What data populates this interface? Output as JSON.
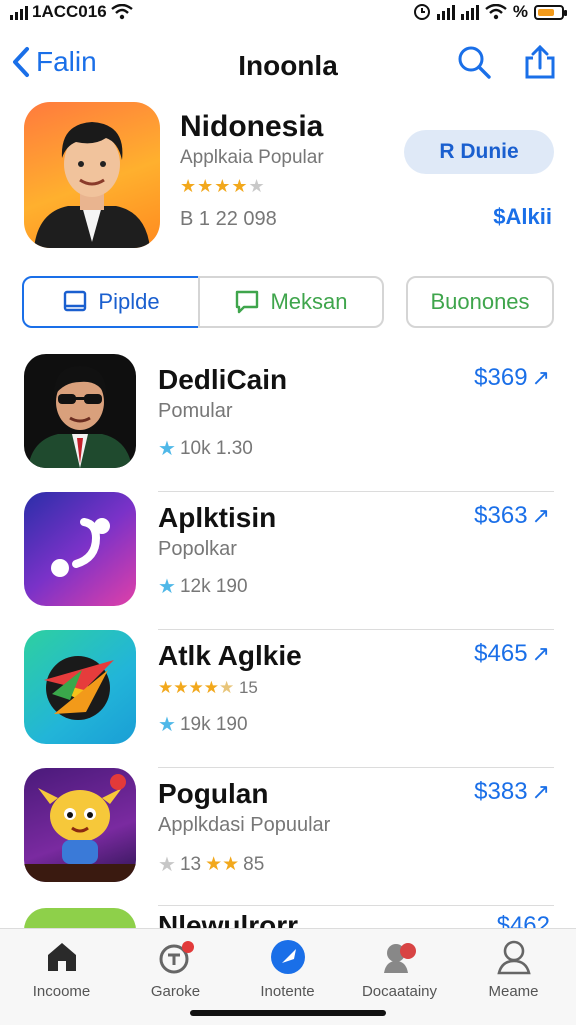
{
  "status_bar": {
    "carrier": "1ACC016",
    "right_label": "%"
  },
  "nav": {
    "back_label": "Falin",
    "title": "Inoonla"
  },
  "featured": {
    "name": "Nidonesia",
    "subtitle": "Applkaia Popular",
    "rating_stars": 4,
    "meta": "B 1 22 098",
    "button_label": "R Dunie",
    "price": "$Alkii"
  },
  "segments": [
    {
      "label": "Piplde",
      "icon": "book-icon"
    },
    {
      "label": "Meksan",
      "icon": "message-icon"
    },
    {
      "label": "Buonones",
      "icon": "tag-icon"
    }
  ],
  "apps": [
    {
      "name": "DedliCain",
      "subtitle": "Pomular",
      "rating_text": "10k 1.30",
      "price": "$369",
      "icon": "sunglasses-avatar-icon"
    },
    {
      "name": "Aplktisin",
      "subtitle": "Popolkar",
      "rating_text": "12k 190",
      "price": "$363",
      "icon": "music-note-icon"
    },
    {
      "name": "Atlk Aglkie",
      "subtitle": "",
      "stars_text": "15",
      "rating_text": "19k 190",
      "price": "$465",
      "icon": "vinyl-disc-icon"
    },
    {
      "name": "Pogulan",
      "subtitle": "Applkdasi Popuular",
      "stars_text": "85",
      "rating_text": "13",
      "price": "$383",
      "icon": "cartoon-character-icon"
    }
  ],
  "peek": {
    "name": "Nlewulrorr",
    "price": "$462"
  },
  "tabbar": [
    {
      "label": "Incoome",
      "icon": "home-icon"
    },
    {
      "label": "Garoke",
      "icon": "chat-badge-icon"
    },
    {
      "label": "Inotente",
      "icon": "play-icon"
    },
    {
      "label": "Docaatainy",
      "icon": "people-badge-icon"
    },
    {
      "label": "Meame",
      "icon": "profile-icon"
    }
  ]
}
